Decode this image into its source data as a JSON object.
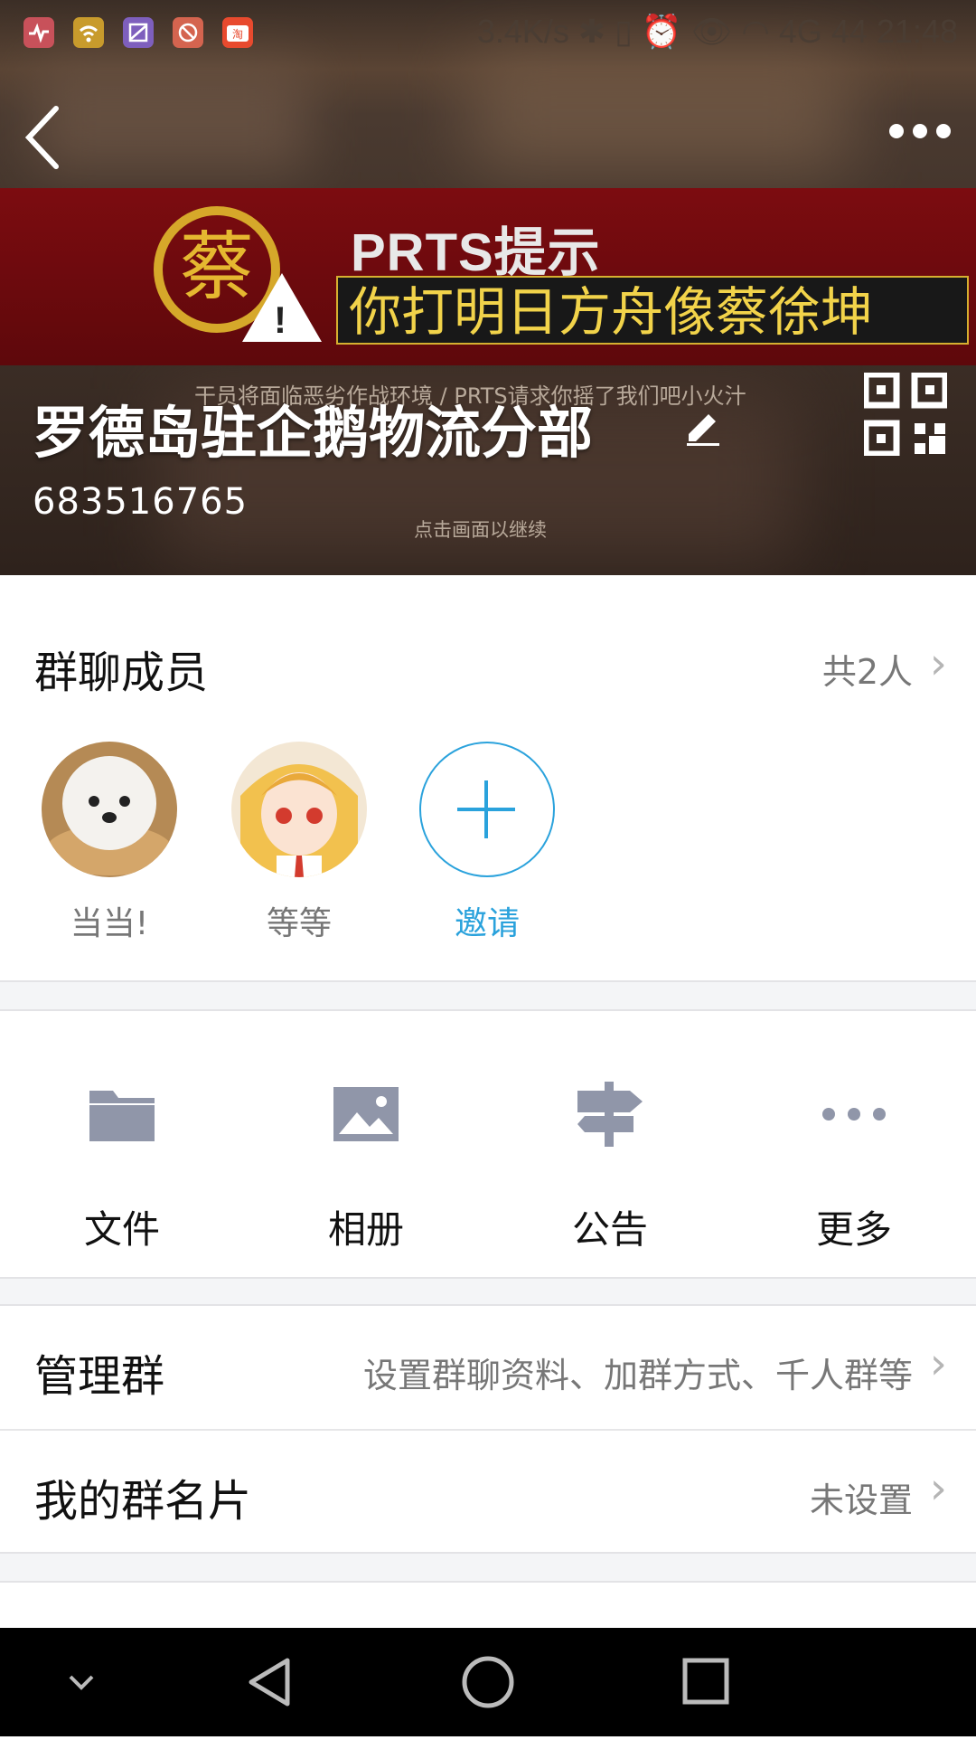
{
  "status_bar": {
    "right_text": "3.4K/s  ✱ ▯ ⏰ 👁 ◠ 4G 44 21:48",
    "net_speed": "3.4K/s",
    "battery": "44",
    "time": "21:48",
    "app_icons": [
      "health-icon",
      "wifi-app-icon",
      "gallery-icon",
      "no-disturb-icon",
      "taobao-icon"
    ]
  },
  "header": {
    "back_label": "‹",
    "more_label": "•••",
    "banner": {
      "logo_char": "蔡",
      "title": "PRTS提示",
      "headline": "你打明日方舟像蔡徐坤",
      "caption": "干员将面临恶劣作战环境 / PRTS请求你摇了我们吧小火汁",
      "tap_hint": "点击画面以继续"
    },
    "group_name": "罗德岛驻企鹅物流分部",
    "group_id": "683516765"
  },
  "members": {
    "title": "群聊成员",
    "count": "共2人",
    "list": [
      {
        "name": "当当!"
      },
      {
        "name": "等等"
      }
    ],
    "invite_label": "邀请"
  },
  "features": [
    {
      "label": "文件",
      "icon": "folder-icon"
    },
    {
      "label": "相册",
      "icon": "photo-icon"
    },
    {
      "label": "公告",
      "icon": "signpost-icon"
    },
    {
      "label": "更多",
      "icon": "more-dots-icon"
    }
  ],
  "rows": {
    "manage": {
      "title": "管理群",
      "value": "设置群聊资料、加群方式、千人群等"
    },
    "card": {
      "title": "我的群名片",
      "value": "未设置"
    }
  },
  "colors": {
    "accent": "#2aa2dc",
    "icon_gray": "#9096a9",
    "divider_bg": "#f4f5f7"
  }
}
